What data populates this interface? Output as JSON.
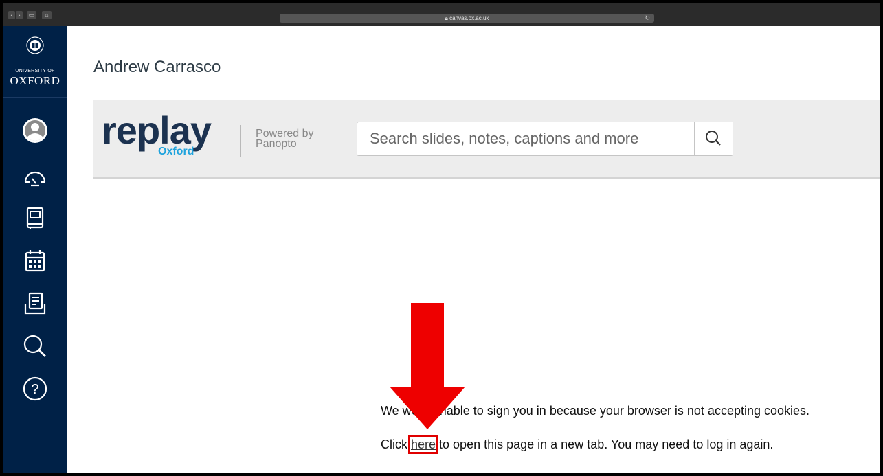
{
  "browser": {
    "url": "canvas.ox.ac.uk",
    "lock_icon": "lock-icon",
    "reload_icon": "reload-icon"
  },
  "sidebar": {
    "logo": {
      "line1": "UNIVERSITY OF",
      "line2": "OXFORD"
    },
    "nav_icons": [
      "account-icon",
      "dashboard-icon",
      "courses-icon",
      "calendar-icon",
      "inbox-icon",
      "search-icon",
      "help-icon"
    ],
    "color": "#002147"
  },
  "page": {
    "user_name": "Andrew Carrasco"
  },
  "replay": {
    "brand": "replay",
    "brand_sub": "Oxford",
    "powered_line1": "Powered by",
    "powered_line2": "Panopto",
    "search_placeholder": "Search slides, notes, captions and more",
    "search_icon": "magnifier-icon"
  },
  "message": {
    "line1": "We were unable to sign you in because your browser is not accepting cookies.",
    "line2_before": "Click ",
    "link": "here",
    "line2_after": " to open this page in a new tab. You may need to log in again."
  },
  "annotation": {
    "arrow_color": "#ee0000",
    "highlight_color": "#e00000"
  }
}
